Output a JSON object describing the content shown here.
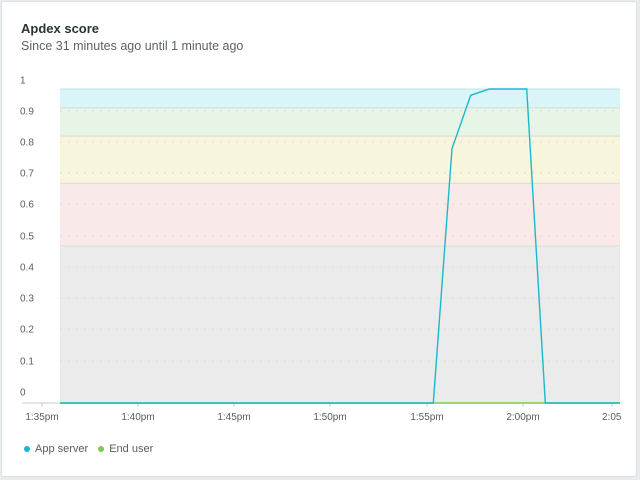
{
  "header": {
    "title": "Apdex score",
    "subtitle": "Since 31 minutes ago until 1 minute ago"
  },
  "colors": {
    "app_server": "#1ab8cc",
    "end_user": "#7ccc4e",
    "band_excellent": "#d9f5f7",
    "band_good": "#e6f5e6",
    "band_fair": "#f7f6dc",
    "band_poor": "#f9e9e9",
    "band_unacceptable": "#ebebeb"
  },
  "chart_data": {
    "type": "line",
    "title": "Apdex score",
    "subtitle": "Since 31 minutes ago until 1 minute ago",
    "xlabel": "",
    "ylabel": "",
    "ylim": [
      0,
      1
    ],
    "y_ticks": [
      "0",
      "0.1",
      "0.2",
      "0.3",
      "0.4",
      "0.5",
      "0.6",
      "0.7",
      "0.8",
      "0.9",
      "1"
    ],
    "x_ticks": [
      "1:35pm",
      "1:40pm",
      "1:45pm",
      "1:50pm",
      "1:55pm",
      "2:00pm",
      "2:05"
    ],
    "grid": true,
    "legend_position": "bottom-left",
    "bands": [
      {
        "from": 0.94,
        "to": 1.0
      },
      {
        "from": 0.85,
        "to": 0.94
      },
      {
        "from": 0.7,
        "to": 0.85
      },
      {
        "from": 0.5,
        "to": 0.7
      },
      {
        "from": 0,
        "to": 0.5
      }
    ],
    "series": [
      {
        "name": "App server",
        "x": [
          "1:35pm",
          "1:55pm",
          "1:56pm",
          "1:57pm",
          "1:58pm",
          "1:59pm",
          "2:00pm",
          "2:01pm",
          "2:05pm"
        ],
        "values": [
          0,
          0,
          0.81,
          0.98,
          1.0,
          1.0,
          1.0,
          0,
          0
        ]
      },
      {
        "name": "End user",
        "x": [
          "1:35pm",
          "2:05pm"
        ],
        "values": [
          0,
          0
        ]
      }
    ]
  }
}
